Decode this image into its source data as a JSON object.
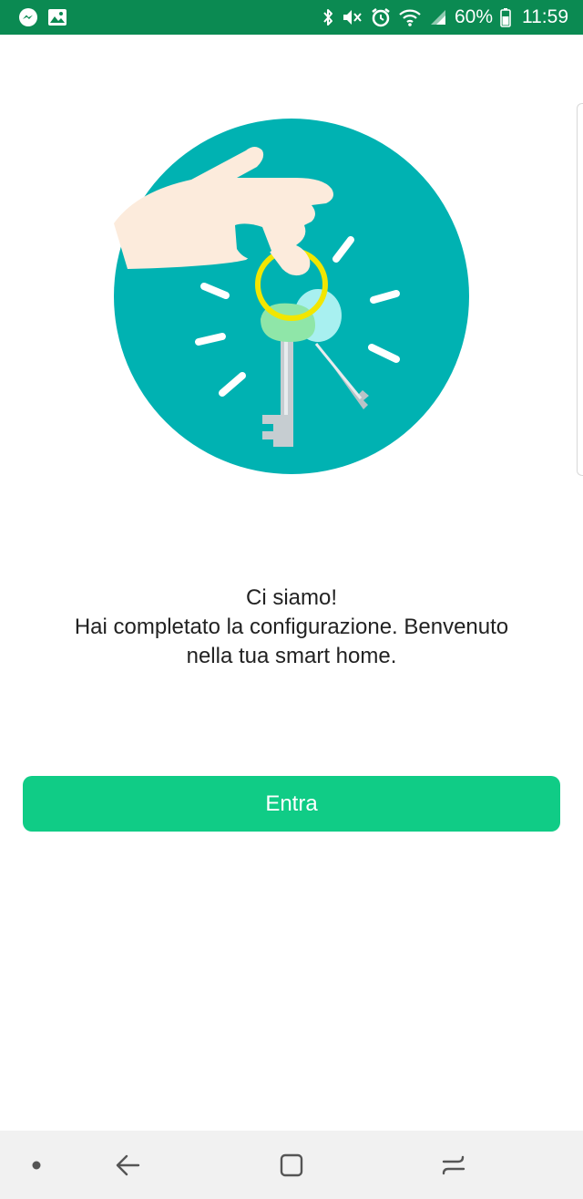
{
  "status_bar": {
    "battery_text": "60%",
    "time": "11:59",
    "background_color": "#0b8a52",
    "left_icons": [
      "messenger-icon",
      "image-icon"
    ],
    "right_icons": [
      "bluetooth-icon",
      "mute-icon",
      "alarm-icon",
      "wifi-icon",
      "signal-icon",
      "battery-icon"
    ]
  },
  "illustration": {
    "icon": "hand-holding-keys-icon",
    "circle_color": "#00b2b2",
    "ring_color": "#f2e600"
  },
  "message": {
    "line1": "Ci siamo!",
    "line2": "Hai completato la configurazione. Benvenuto",
    "line3": "nella tua smart home."
  },
  "enter_button": {
    "label": "Entra",
    "color": "#10cc86"
  },
  "nav_bar": {
    "icons": [
      "nav-dot-icon",
      "back-icon",
      "home-icon",
      "recents-icon"
    ]
  }
}
